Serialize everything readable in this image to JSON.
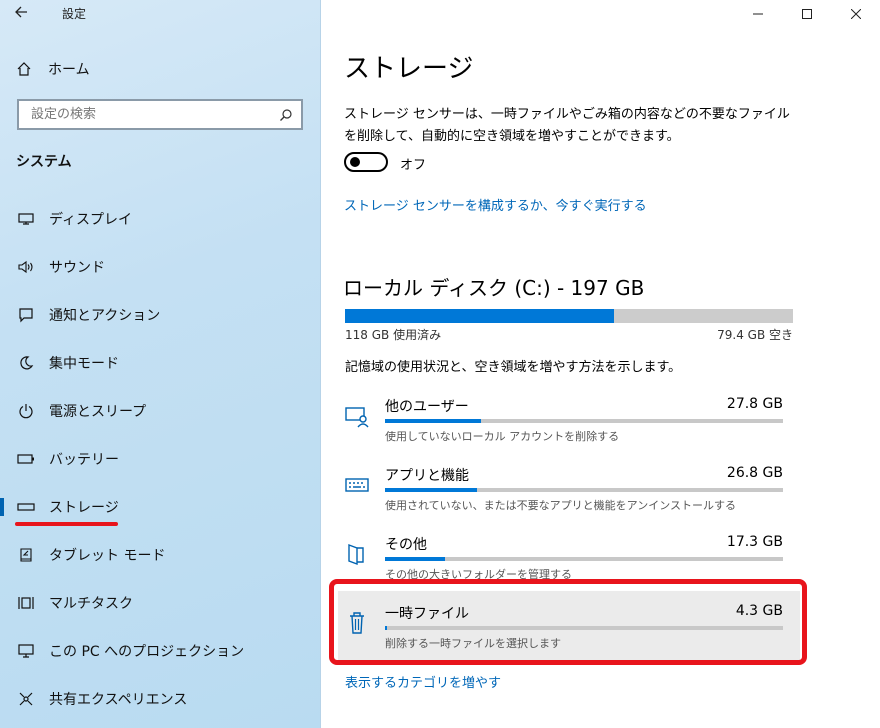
{
  "window": {
    "title": "設定"
  },
  "sidebar": {
    "home_label": "ホーム",
    "search_placeholder": "設定の検索",
    "section": "システム",
    "items": [
      {
        "label": "ディスプレイ",
        "icon": "display-icon"
      },
      {
        "label": "サウンド",
        "icon": "speaker-icon"
      },
      {
        "label": "通知とアクション",
        "icon": "notification-icon"
      },
      {
        "label": "集中モード",
        "icon": "moon-icon"
      },
      {
        "label": "電源とスリープ",
        "icon": "power-icon"
      },
      {
        "label": "バッテリー",
        "icon": "battery-icon"
      },
      {
        "label": "ストレージ",
        "icon": "storage-icon",
        "active": true
      },
      {
        "label": "タブレット モード",
        "icon": "tablet-icon"
      },
      {
        "label": "マルチタスク",
        "icon": "multitask-icon"
      },
      {
        "label": "この PC へのプロジェクション",
        "icon": "projection-icon"
      },
      {
        "label": "共有エクスペリエンス",
        "icon": "share-icon"
      }
    ]
  },
  "main": {
    "title": "ストレージ",
    "description": "ストレージ センサーは、一時ファイルやごみ箱の内容などの不要なファイルを削除して、自動的に空き領域を増やすことができます。",
    "toggle_label": "オフ",
    "toggle_on": false,
    "configure_link": "ストレージ センサーを構成するか、今すぐ実行する",
    "disk": {
      "title": "ローカル ディスク (C:) - 197 GB",
      "used": "118 GB 使用済み",
      "free": "79.4 GB 空き",
      "used_fraction": 0.6
    },
    "hint": "記憶域の使用状況と、空き領域を増やす方法を示します。",
    "categories": [
      {
        "name": "他のユーザー",
        "size": "27.8 GB",
        "sub": "使用していないローカル アカウントを削除する",
        "fraction": 0.24,
        "icon": "users-icon"
      },
      {
        "name": "アプリと機能",
        "size": "26.8 GB",
        "sub": "使用されていない、または不要なアプリと機能をアンインストールする",
        "fraction": 0.23,
        "icon": "keyboard-icon"
      },
      {
        "name": "その他",
        "size": "17.3 GB",
        "sub": "その他の大きいフォルダーを管理する",
        "fraction": 0.15,
        "icon": "folder-icon"
      },
      {
        "name": "一時ファイル",
        "size": "4.3 GB",
        "sub": "削除する一時ファイルを選択します",
        "fraction": 0.004,
        "icon": "trash-icon"
      }
    ],
    "more_link": "表示するカテゴリを増やす"
  },
  "colors": {
    "accent": "#0078d7",
    "link": "#0067b8",
    "annotation": "#e8141c"
  }
}
